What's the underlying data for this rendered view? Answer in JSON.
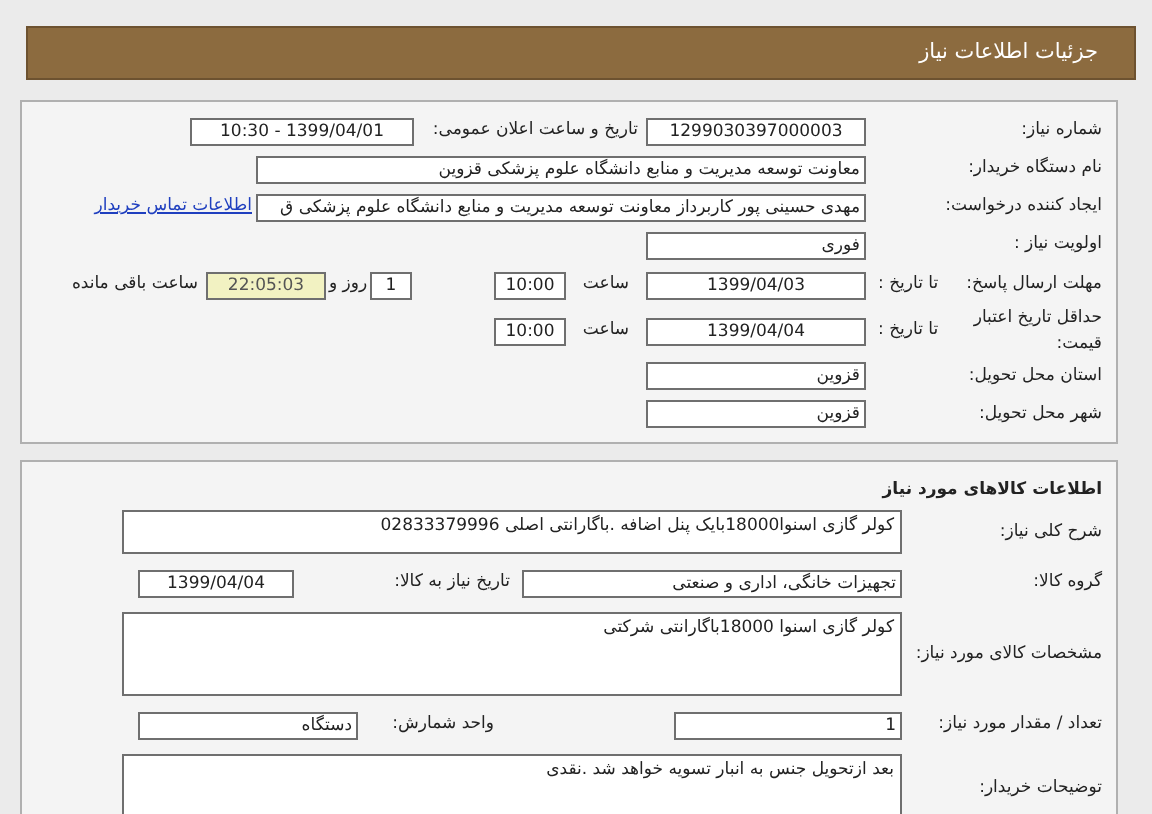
{
  "header": {
    "title": "جزئیات اطلاعات نیاز"
  },
  "need_info": {
    "rows": [
      {
        "kind": "pair",
        "label": "شماره نیاز:",
        "value": "1299030397000003",
        "label_2": "تاریخ و ساعت اعلان عمومی:",
        "value_2": "1399/04/01 - 10:30"
      },
      {
        "kind": "long",
        "label": "نام دستگاه خریدار:",
        "value": "معاونت توسعه مدیریت و منابع دانشگاه علوم پزشکی قزوین"
      },
      {
        "kind": "long_link",
        "label": "ایجاد کننده درخواست:",
        "value": "مهدی حسینی پور کاربرداز معاونت توسعه مدیریت و منابع دانشگاه علوم پزشکی ق",
        "link": "اطلاعات تماس خریدار"
      },
      {
        "kind": "short",
        "label": "اولویت نیاز :",
        "value": "فوری"
      },
      {
        "kind": "deadline",
        "label": "مهلت ارسال پاسخ:",
        "sublabel": "تا تاریخ :",
        "date": "1399/04/03",
        "time_label": "ساعت",
        "time": "10:00",
        "days": "1",
        "days_label": "روز و",
        "remaining": "22:05:03",
        "remaining_label": "ساعت باقی مانده"
      },
      {
        "kind": "validity",
        "label": "حداقل تاریخ اعتبار قیمت:",
        "sublabel": "تا تاریخ :",
        "date": "1399/04/04",
        "time_label": "ساعت",
        "time": "10:00"
      },
      {
        "kind": "short",
        "label": "استان محل تحویل:",
        "value": "قزوین"
      },
      {
        "kind": "short",
        "label": "شهر محل تحویل:",
        "value": "قزوین"
      }
    ]
  },
  "goods": {
    "title": "اطلاعات کالاهای مورد نیاز",
    "rows": [
      {
        "kind": "summary",
        "label": "شرح کلی نیاز:",
        "value": "کولر گازی اسنوا18000بایک پنل اضافه .باگارانتی اصلی 02833379996"
      },
      {
        "kind": "pair",
        "label": "گروه کالا:",
        "value": "تجهیزات خانگی، اداری و صنعتی",
        "label_2": "تاریخ نیاز به کالا:",
        "value_2": "1399/04/04"
      },
      {
        "kind": "spec",
        "label": "مشخصات کالای مورد نیاز:",
        "value": "کولر گازی اسنوا 18000باگارانتی شرکتی"
      },
      {
        "kind": "quantity",
        "label": "تعداد / مقدار مورد نیاز:",
        "value": "1",
        "label_2": "واحد شمارش:",
        "value_2": "دستگاه"
      },
      {
        "kind": "notes",
        "label": "توضیحات خریدار:",
        "value": "بعد ازتحویل جنس به انبار تسویه خواهد شد .نقدی"
      }
    ]
  }
}
